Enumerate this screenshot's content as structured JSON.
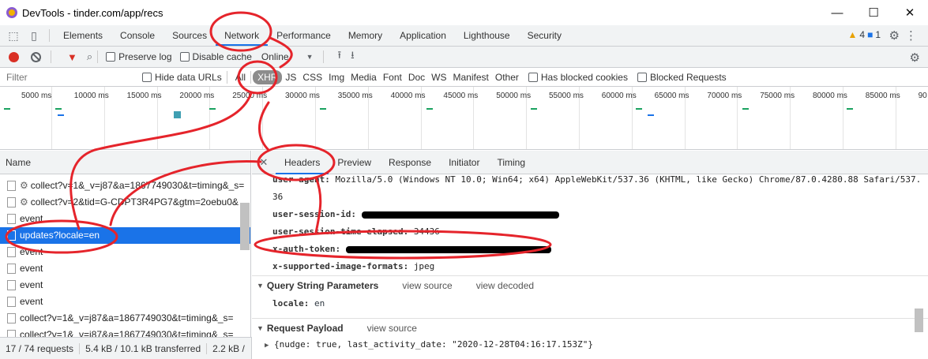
{
  "window": {
    "title": "DevTools - tinder.com/app/recs",
    "controls": [
      "—",
      "☐",
      "✕"
    ]
  },
  "tabs": [
    "Elements",
    "Console",
    "Sources",
    "Network",
    "Performance",
    "Memory",
    "Application",
    "Lighthouse",
    "Security"
  ],
  "issues": {
    "warnings": "4",
    "info": "1"
  },
  "toolbar": {
    "preserve_log": "Preserve log",
    "disable_cache": "Disable cache",
    "throttle": "Online"
  },
  "filter": {
    "placeholder": "Filter",
    "hide_data_urls": "Hide data URLs",
    "types": [
      "All",
      "XHR",
      "JS",
      "CSS",
      "Img",
      "Media",
      "Font",
      "Doc",
      "WS",
      "Manifest",
      "Other"
    ],
    "has_blocked_cookies": "Has blocked cookies",
    "blocked_requests": "Blocked Requests"
  },
  "timeline": {
    "ticks": [
      "5000 ms",
      "10000 ms",
      "15000 ms",
      "20000 ms",
      "25000 ms",
      "30000 ms",
      "35000 ms",
      "40000 ms",
      "45000 ms",
      "50000 ms",
      "55000 ms",
      "60000 ms",
      "65000 ms",
      "70000 ms",
      "75000 ms",
      "80000 ms",
      "85000 ms",
      "90"
    ]
  },
  "requests": {
    "header": "Name",
    "rows": [
      "collect?v=1&_v=j87&a=1867749030&t=timing&_s=",
      "collect?v=2&tid=G-CDPT3R4PG7&gtm=2oebu0&",
      "event",
      "updates?locale=en",
      "event",
      "event",
      "event",
      "event",
      "collect?v=1&_v=j87&a=1867749030&t=timing&_s=",
      "collect?v=1&_v=j87&a=1867749030&t=timing&_s="
    ]
  },
  "status": {
    "requests": "17 / 74 requests",
    "transferred": "5.4 kB / 10.1 kB transferred",
    "resources": "2.2 kB /"
  },
  "detail": {
    "tabs": [
      "Headers",
      "Preview",
      "Response",
      "Initiator",
      "Timing"
    ],
    "headers": [
      {
        "name": "user-agent:",
        "value": "Mozilla/5.0 (Windows NT 10.0; Win64; x64) AppleWebKit/537.36 (KHTML, like Gecko) Chrome/87.0.4280.88 Safari/537.",
        "redacted": false
      },
      {
        "name": "",
        "value": "36",
        "redacted": false
      },
      {
        "name": "user-session-id:",
        "value": "",
        "redacted": true
      },
      {
        "name": "user-session-time-elapsed:",
        "value": "34436",
        "redacted": false
      },
      {
        "name": "x-auth-token:",
        "value": "",
        "redacted": true
      },
      {
        "name": "x-supported-image-formats:",
        "value": "jpeg",
        "redacted": false
      }
    ],
    "query_section": {
      "title": "Query String Parameters",
      "view_source": "view source",
      "view_decoded": "view decoded"
    },
    "query_params": [
      {
        "key": "locale:",
        "value": "en"
      }
    ],
    "payload_section": {
      "title": "Request Payload",
      "view_source": "view source"
    },
    "payload": "{nudge: true, last_activity_date: \"2020-12-28T04:16:17.153Z\"}"
  },
  "colors": {
    "accent": "#1a73e8",
    "annotation": "#e5242b",
    "record": "#d93025"
  }
}
